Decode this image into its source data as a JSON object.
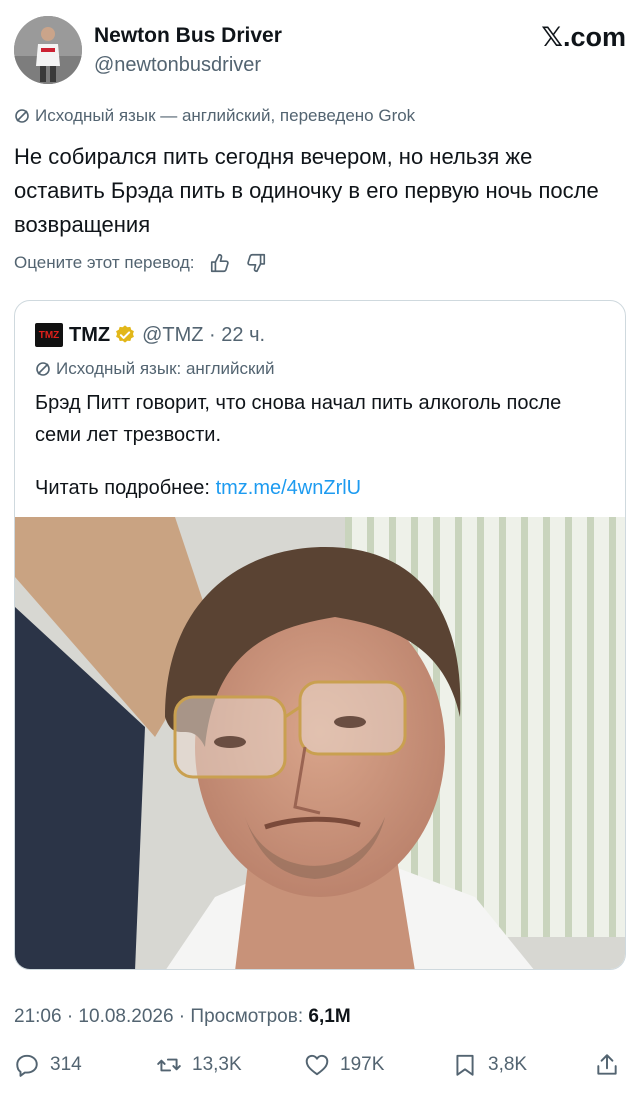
{
  "header": {
    "name": "Newton Bus Driver",
    "handle": "@newtonbusdriver",
    "site": "𝕏.com"
  },
  "tweet": {
    "translation_note": "Исходный язык — английский, переведено Grok",
    "text": "Не собирался пить сегодня вечером, но нельзя же оставить Брэда пить в одиночку в его первую ночь после возвращения",
    "rate_label": "Оцените этот перевод:"
  },
  "quote": {
    "logo_text": "TMZ",
    "name": "TMZ",
    "handle_time": "@TMZ · 22 ч.",
    "note": "Исходный язык: английский",
    "text": "Брэд Питт говорит, что снова начал пить алкоголь после семи лет трезвости.",
    "read_more_label": "Читать подробнее:",
    "link": "tmz.me/4wnZrlU"
  },
  "meta": {
    "timestamp": "21:06 · 10.08.2026 · Просмотров: ",
    "views": "6,1M"
  },
  "actions": {
    "replies": "314",
    "reposts": "13,3K",
    "likes": "197K",
    "bookmarks": "3,8K"
  },
  "colors": {
    "accent": "#1d9bf0",
    "secondary_text": "#536471",
    "verified_gold": "#e2b719"
  }
}
